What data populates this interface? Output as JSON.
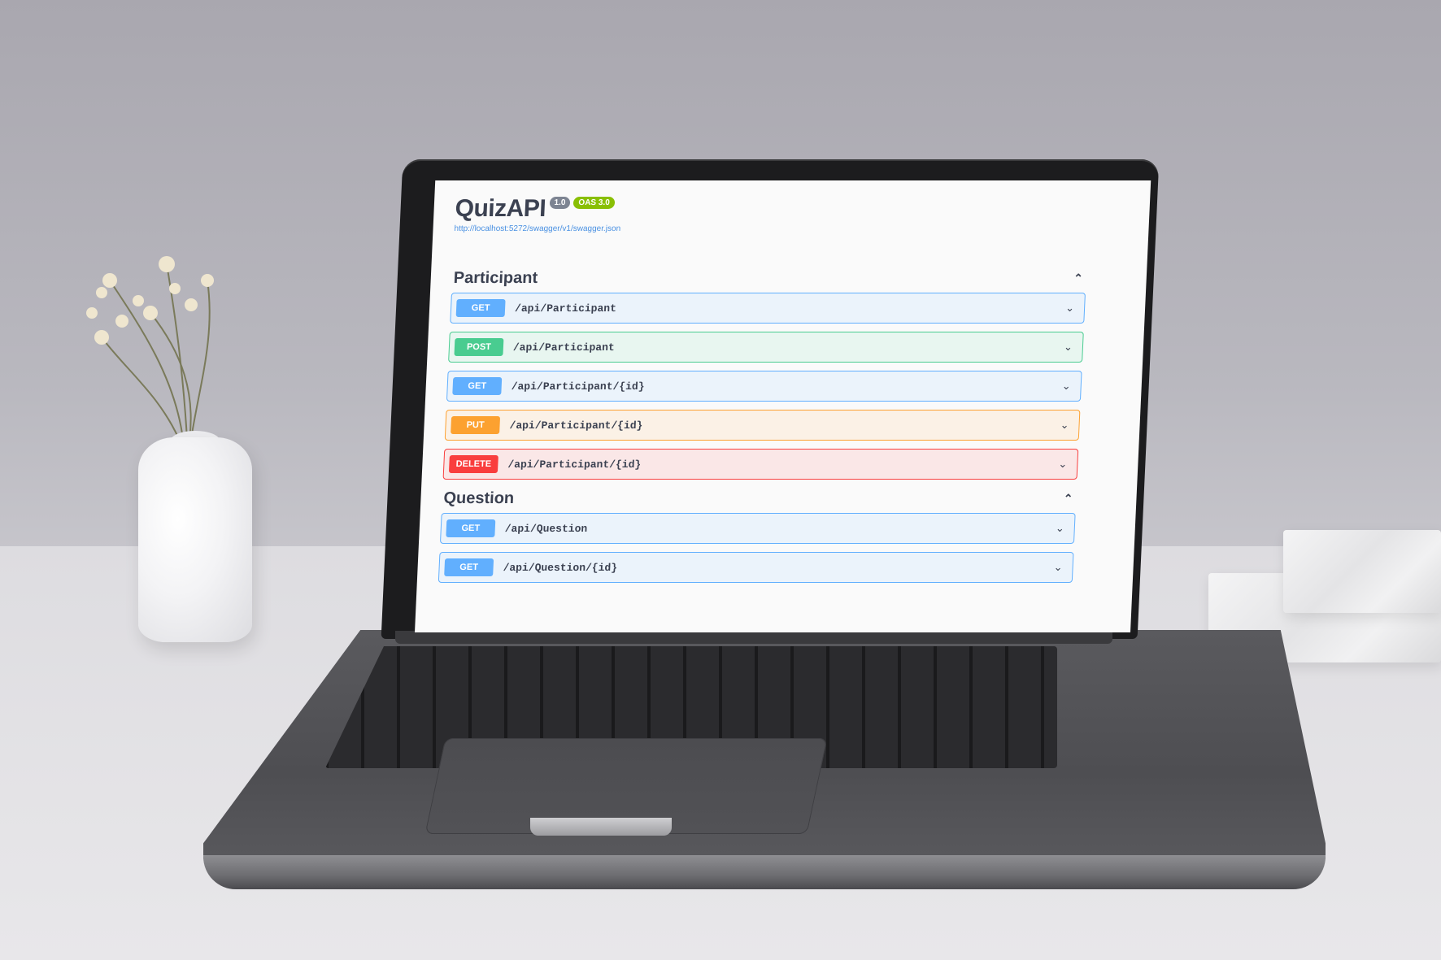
{
  "app": {
    "title": "QuizAPI",
    "version_badge": "1.0",
    "oas_badge": "OAS 3.0",
    "spec_url": "http://localhost:5272/swagger/v1/swagger.json"
  },
  "sections": [
    {
      "name": "Participant",
      "operations": [
        {
          "method": "GET",
          "path": "/api/Participant"
        },
        {
          "method": "POST",
          "path": "/api/Participant"
        },
        {
          "method": "GET",
          "path": "/api/Participant/{id}"
        },
        {
          "method": "PUT",
          "path": "/api/Participant/{id}"
        },
        {
          "method": "DELETE",
          "path": "/api/Participant/{id}"
        }
      ]
    },
    {
      "name": "Question",
      "operations": [
        {
          "method": "GET",
          "path": "/api/Question"
        },
        {
          "method": "GET",
          "path": "/api/Question/{id}"
        }
      ]
    }
  ],
  "icons": {
    "collapse": "chevron-up-icon",
    "expand": "chevron-down-icon"
  },
  "colors": {
    "get": "#61affe",
    "post": "#49cc90",
    "put": "#fca130",
    "delete": "#f93e3e",
    "oas_badge": "#89bf04",
    "version_badge": "#7d8492"
  }
}
